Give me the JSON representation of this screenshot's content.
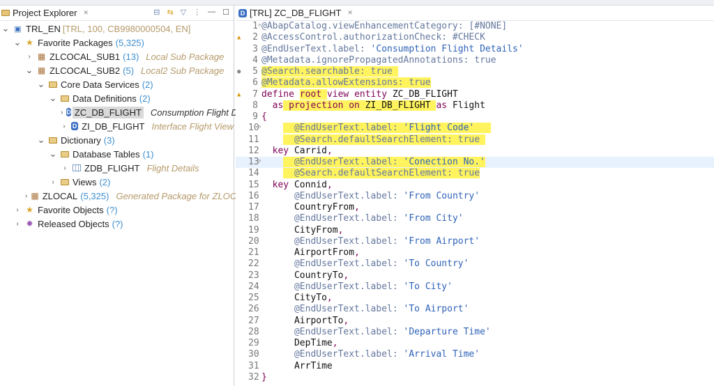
{
  "explorer": {
    "title": "Project Explorer",
    "tree": [
      {
        "level": 0,
        "chev": "open",
        "icon": "sys",
        "name": "TRL_EN",
        "meta": "[TRL, 100, CB9980000504, EN]"
      },
      {
        "level": 1,
        "chev": "open",
        "icon": "star",
        "name": "Favorite Packages",
        "count": "(5,325)"
      },
      {
        "level": 2,
        "chev": "closed",
        "icon": "pkg",
        "name": "ZLCOCAL_SUB1",
        "count": "(13)",
        "desc": "Local Sub Package"
      },
      {
        "level": 2,
        "chev": "open",
        "icon": "pkg",
        "name": "ZLCOCAL_SUB2",
        "count": "(5)",
        "desc": "Local2 Sub Package"
      },
      {
        "level": 3,
        "chev": "open",
        "icon": "fold",
        "name": "Core Data Services",
        "count": "(2)"
      },
      {
        "level": 4,
        "chev": "open",
        "icon": "fold",
        "name": "Data Definitions",
        "count": "(2)"
      },
      {
        "level": 5,
        "chev": "closed",
        "icon": "ddl",
        "name": "ZC_DB_FLIGHT",
        "desc": "Consumption Flight Details",
        "selected": true
      },
      {
        "level": 5,
        "chev": "closed",
        "icon": "ddl",
        "name": "ZI_DB_FLIGHT",
        "desc": "Interface Flight View"
      },
      {
        "level": 3,
        "chev": "open",
        "icon": "fold",
        "name": "Dictionary",
        "count": "(3)"
      },
      {
        "level": 4,
        "chev": "open",
        "icon": "fold",
        "name": "Database Tables",
        "count": "(1)"
      },
      {
        "level": 5,
        "chev": "closed",
        "icon": "tbl",
        "name": "ZDB_FLIGHT",
        "desc": "Flight Details"
      },
      {
        "level": 4,
        "chev": "closed",
        "icon": "fold",
        "name": "Views",
        "count": "(2)"
      },
      {
        "level": 2,
        "chev": "closed",
        "icon": "pkg",
        "name": "ZLOCAL",
        "count": "(5,325)",
        "desc": "Generated Package for ZLOCAL"
      },
      {
        "level": 1,
        "chev": "closed",
        "icon": "star",
        "name": "Favorite Objects",
        "count": "(?)"
      },
      {
        "level": 1,
        "chev": "closed",
        "icon": "gear",
        "name": "Released Objects",
        "count": "(?)"
      }
    ]
  },
  "editor": {
    "tab_title": "[TRL] ZC_DB_FLIGHT",
    "current_line": 13,
    "lines": [
      {
        "n": "1",
        "fold": true,
        "tk": [
          [
            "ann",
            "@AbapCatalog.viewEnhancementCategory: [#NONE]"
          ]
        ]
      },
      {
        "n": "2",
        "mk": "warn",
        "tk": [
          [
            "ann",
            "@AccessControl.authorizationCheck: #CHECK"
          ]
        ]
      },
      {
        "n": "3",
        "tk": [
          [
            "ann",
            "@EndUserText.label: "
          ],
          [
            "str",
            "'Consumption Flight Details'"
          ]
        ]
      },
      {
        "n": "4",
        "tk": [
          [
            "ann",
            "@Metadata.ignorePropagatedAnnotations: true"
          ]
        ]
      },
      {
        "n": "5",
        "mk": "info",
        "tk": [
          [
            "ann",
            "@Search.searchable: true ",
            1
          ]
        ]
      },
      {
        "n": "6",
        "tk": [
          [
            "ann",
            "@Metadata.allowExtensions: true",
            1
          ]
        ]
      },
      {
        "n": "7",
        "mk": "warn",
        "tk": [
          [
            "kw",
            "define "
          ],
          [
            "kw",
            "root ",
            1
          ],
          [
            "kw",
            "view entity "
          ],
          [
            "id",
            "ZC_DB_FLIGHT"
          ]
        ]
      },
      {
        "n": "8",
        "tk": [
          [
            "id",
            "  "
          ],
          [
            "kw",
            "as"
          ],
          [
            "kw",
            " projection on ",
            1
          ],
          [
            "id",
            "ZI_DB_FLIGHT ",
            1
          ],
          [
            "kw",
            "as "
          ],
          [
            "id",
            "Flight"
          ]
        ]
      },
      {
        "n": "9",
        "tk": [
          [
            "pn",
            "{"
          ]
        ]
      },
      {
        "n": "10",
        "fold": true,
        "tk": [
          [
            "id",
            "    "
          ],
          [
            "ann",
            "  @EndUserText.label: ",
            1
          ],
          [
            "str",
            "'Flight Code'   ",
            1
          ]
        ]
      },
      {
        "n": "11",
        "tk": [
          [
            "id",
            "    "
          ],
          [
            "ann",
            "  @Search.defaultSearchElement: true ",
            1
          ]
        ]
      },
      {
        "n": "12",
        "tk": [
          [
            "id",
            "  "
          ],
          [
            "kw",
            "key "
          ],
          [
            "id",
            "Carrid"
          ],
          [
            "pn",
            ","
          ]
        ]
      },
      {
        "n": "13",
        "fold": true,
        "tk": [
          [
            "id",
            "    "
          ],
          [
            "ann",
            "  @EndUserText.label: ",
            1
          ],
          [
            "str",
            "'Conection No.'",
            1
          ]
        ]
      },
      {
        "n": "14",
        "tk": [
          [
            "id",
            "    "
          ],
          [
            "ann",
            "  @Search.defaultSearchElement: true",
            1
          ]
        ]
      },
      {
        "n": "15",
        "tk": [
          [
            "id",
            "  "
          ],
          [
            "kw",
            "key "
          ],
          [
            "id",
            "Connid"
          ],
          [
            "pn",
            ","
          ]
        ]
      },
      {
        "n": "16",
        "tk": [
          [
            "id",
            "      "
          ],
          [
            "ann",
            "@EndUserText.label: "
          ],
          [
            "str",
            "'From Country'"
          ]
        ]
      },
      {
        "n": "17",
        "tk": [
          [
            "id",
            "      CountryFrom"
          ],
          [
            "pn",
            ","
          ]
        ]
      },
      {
        "n": "18",
        "tk": [
          [
            "id",
            "      "
          ],
          [
            "ann",
            "@EndUserText.label: "
          ],
          [
            "str",
            "'From City'"
          ]
        ]
      },
      {
        "n": "19",
        "tk": [
          [
            "id",
            "      CityFrom"
          ],
          [
            "pn",
            ","
          ]
        ]
      },
      {
        "n": "20",
        "tk": [
          [
            "id",
            "      "
          ],
          [
            "ann",
            "@EndUserText.label: "
          ],
          [
            "str",
            "'From Airport'"
          ]
        ]
      },
      {
        "n": "21",
        "tk": [
          [
            "id",
            "      AirportFrom"
          ],
          [
            "pn",
            ","
          ]
        ]
      },
      {
        "n": "22",
        "tk": [
          [
            "id",
            "      "
          ],
          [
            "ann",
            "@EndUserText.label: "
          ],
          [
            "str",
            "'To Country'"
          ]
        ]
      },
      {
        "n": "23",
        "tk": [
          [
            "id",
            "      CountryTo"
          ],
          [
            "pn",
            ","
          ]
        ]
      },
      {
        "n": "24",
        "tk": [
          [
            "id",
            "      "
          ],
          [
            "ann",
            "@EndUserText.label: "
          ],
          [
            "str",
            "'To City'"
          ]
        ]
      },
      {
        "n": "25",
        "tk": [
          [
            "id",
            "      CityTo"
          ],
          [
            "pn",
            ","
          ]
        ]
      },
      {
        "n": "26",
        "tk": [
          [
            "id",
            "      "
          ],
          [
            "ann",
            "@EndUserText.label: "
          ],
          [
            "str",
            "'To Airport'"
          ]
        ]
      },
      {
        "n": "27",
        "tk": [
          [
            "id",
            "      AirportTo"
          ],
          [
            "pn",
            ","
          ]
        ]
      },
      {
        "n": "28",
        "tk": [
          [
            "id",
            "      "
          ],
          [
            "ann",
            "@EndUserText.label: "
          ],
          [
            "str",
            "'Departure Time'"
          ]
        ]
      },
      {
        "n": "29",
        "tk": [
          [
            "id",
            "      DepTime"
          ],
          [
            "pn",
            ","
          ]
        ]
      },
      {
        "n": "30",
        "tk": [
          [
            "id",
            "      "
          ],
          [
            "ann",
            "@EndUserText.label: "
          ],
          [
            "str",
            "'Arrival Time'"
          ]
        ]
      },
      {
        "n": "31",
        "tk": [
          [
            "id",
            "      ArrTime"
          ]
        ]
      },
      {
        "n": "32",
        "tk": [
          [
            "pn",
            "}"
          ]
        ]
      }
    ]
  }
}
